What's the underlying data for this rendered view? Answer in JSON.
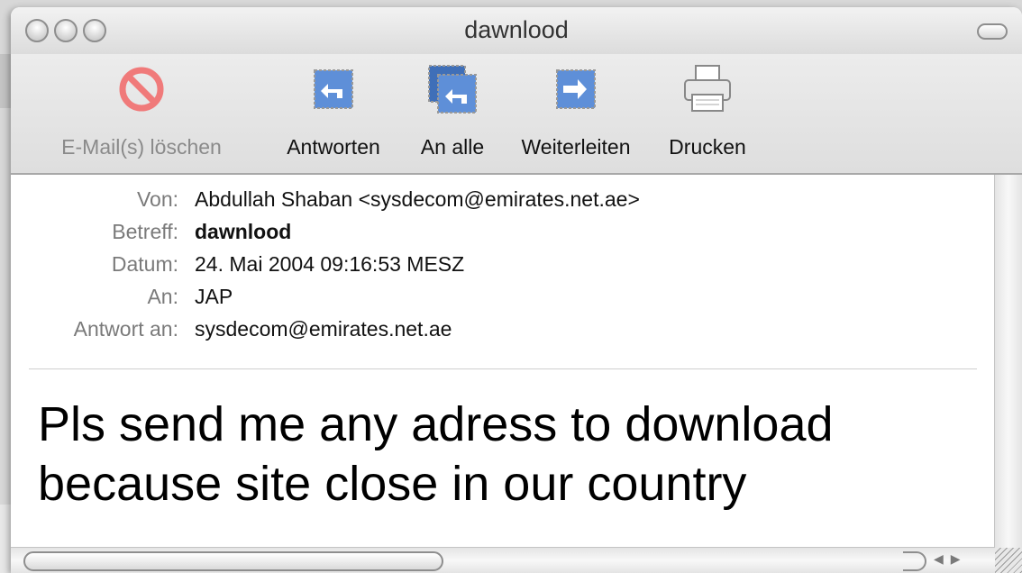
{
  "window": {
    "title": "dawnlood"
  },
  "toolbar": {
    "delete_label": "E-Mail(s) löschen",
    "reply_label": "Antworten",
    "reply_all_label": "An alle",
    "forward_label": "Weiterleiten",
    "print_label": "Drucken",
    "icons": {
      "delete": "no-entry-icon",
      "reply": "reply-arrow-icon",
      "reply_all": "reply-all-arrow-icon",
      "forward": "forward-arrow-icon",
      "print": "printer-icon"
    },
    "colors": {
      "delete_icon": "#f07a7a",
      "arrow_icon": "#5e8fd8"
    }
  },
  "headers": [
    {
      "label": "Von:",
      "value": "Abdullah Shaban <sysdecom@emirates.net.ae>"
    },
    {
      "label": "Betreff:",
      "value": "dawnlood"
    },
    {
      "label": "Datum:",
      "value": "24. Mai 2004 09:16:53 MESZ"
    },
    {
      "label": "An:",
      "value": "JAP"
    },
    {
      "label": "Antwort an:",
      "value": "sysdecom@emirates.net.ae"
    }
  ],
  "message": {
    "line1": "Pls send me any adress to download",
    "line2": "because site close in our country"
  }
}
